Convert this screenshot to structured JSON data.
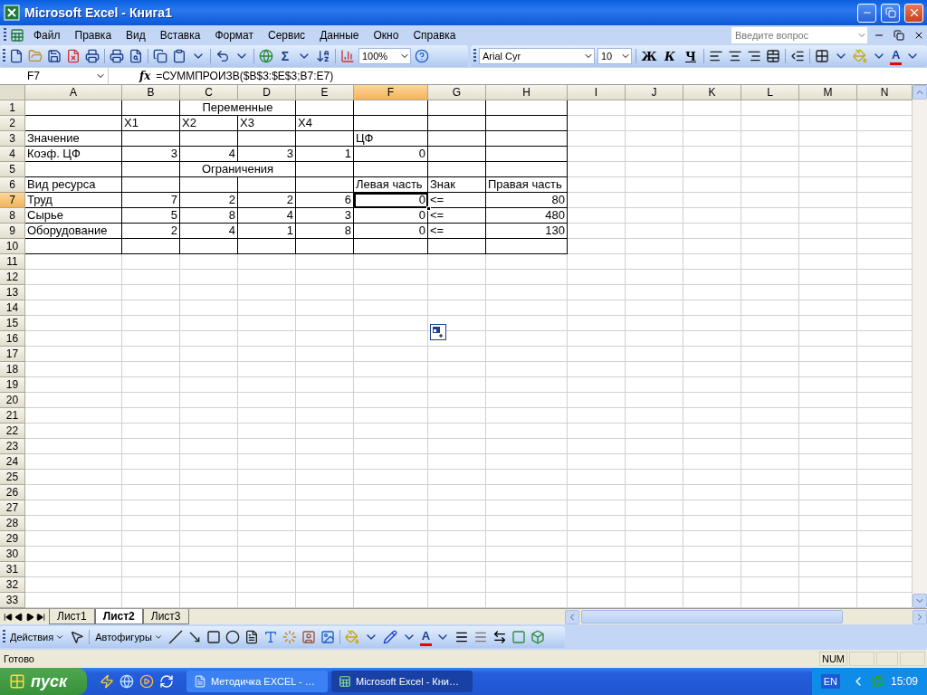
{
  "window": {
    "title": "Microsoft Excel - Книга1"
  },
  "menu": [
    "Файл",
    "Правка",
    "Вид",
    "Вставка",
    "Формат",
    "Сервис",
    "Данные",
    "Окно",
    "Справка"
  ],
  "help_box": {
    "placeholder": "Введите вопрос"
  },
  "standard_toolbar": {
    "zoom": "100%",
    "sum": "Σ"
  },
  "formatting_toolbar": {
    "font": "Arial Cyr",
    "size": "10",
    "bold": "Ж",
    "italic": "К",
    "underline": "Ч",
    "font_color": "A"
  },
  "formula_bar": {
    "name_box": "F7",
    "function_label": "fx",
    "formula": "=СУММПРОИЗВ($B$3:$E$3;B7:E7)"
  },
  "sheet": {
    "columns": [
      {
        "label": "A",
        "selected": false
      },
      {
        "label": "B",
        "selected": false
      },
      {
        "label": "C",
        "selected": false
      },
      {
        "label": "D",
        "selected": false
      },
      {
        "label": "E",
        "selected": false
      },
      {
        "label": "F",
        "selected": true
      },
      {
        "label": "G",
        "selected": false
      },
      {
        "label": "H",
        "selected": false
      },
      {
        "label": "I",
        "selected": false
      },
      {
        "label": "J",
        "selected": false
      },
      {
        "label": "K",
        "selected": false
      },
      {
        "label": "L",
        "selected": false
      },
      {
        "label": "M",
        "selected": false
      },
      {
        "label": "N",
        "selected": false
      }
    ],
    "rows": [
      {
        "number": "1",
        "selected": false,
        "cells": [
          {
            "kind": "empty"
          },
          {
            "kind": "empty"
          },
          {
            "kind": "title",
            "value": "Переменные"
          },
          {
            "kind": "empty"
          },
          {
            "kind": "empty"
          },
          {
            "kind": "empty"
          },
          {
            "kind": "empty"
          }
        ]
      },
      {
        "number": "2",
        "selected": false,
        "cells": [
          {
            "kind": "empty"
          },
          {
            "kind": "text",
            "value": "X1"
          },
          {
            "kind": "text",
            "value": "X2"
          },
          {
            "kind": "text",
            "value": "X3"
          },
          {
            "kind": "text",
            "value": "X4"
          },
          {
            "kind": "empty"
          },
          {
            "kind": "empty"
          },
          {
            "kind": "empty"
          }
        ]
      },
      {
        "number": "3",
        "selected": false,
        "cells": [
          {
            "kind": "text",
            "value": "Значение"
          },
          {
            "kind": "empty"
          },
          {
            "kind": "empty"
          },
          {
            "kind": "empty"
          },
          {
            "kind": "empty"
          },
          {
            "kind": "text",
            "value": "ЦФ"
          },
          {
            "kind": "empty"
          },
          {
            "kind": "empty"
          }
        ]
      },
      {
        "number": "4",
        "selected": false,
        "cells": [
          {
            "kind": "text",
            "value": "Коэф. ЦФ"
          },
          {
            "kind": "number",
            "value": "3"
          },
          {
            "kind": "number",
            "value": "4"
          },
          {
            "kind": "number",
            "value": "3"
          },
          {
            "kind": "number",
            "value": "1"
          },
          {
            "kind": "number",
            "value": "0"
          },
          {
            "kind": "empty"
          },
          {
            "kind": "empty"
          }
        ]
      },
      {
        "number": "5",
        "selected": false,
        "cells": [
          {
            "kind": "empty"
          },
          {
            "kind": "empty"
          },
          {
            "kind": "title",
            "value": "Ограничения"
          },
          {
            "kind": "empty"
          },
          {
            "kind": "empty"
          },
          {
            "kind": "empty"
          },
          {
            "kind": "empty"
          }
        ]
      },
      {
        "number": "6",
        "selected": false,
        "cells": [
          {
            "kind": "text",
            "value": "Вид ресурса"
          },
          {
            "kind": "empty"
          },
          {
            "kind": "empty"
          },
          {
            "kind": "empty"
          },
          {
            "kind": "empty"
          },
          {
            "kind": "text",
            "value": "Левая часть"
          },
          {
            "kind": "text",
            "value": "Знак"
          },
          {
            "kind": "text",
            "value": "Правая часть"
          }
        ]
      },
      {
        "number": "7",
        "selected": true,
        "cells": [
          {
            "kind": "text",
            "value": "Труд"
          },
          {
            "kind": "number",
            "value": "7"
          },
          {
            "kind": "number",
            "value": "2"
          },
          {
            "kind": "number",
            "value": "2"
          },
          {
            "kind": "number",
            "value": "6"
          },
          {
            "kind": "number",
            "value": "0"
          },
          {
            "kind": "text",
            "value": "<="
          },
          {
            "kind": "number",
            "value": "80"
          }
        ]
      },
      {
        "number": "8",
        "selected": false,
        "cells": [
          {
            "kind": "text",
            "value": "Сырье"
          },
          {
            "kind": "number",
            "value": "5"
          },
          {
            "kind": "number",
            "value": "8"
          },
          {
            "kind": "number",
            "value": "4"
          },
          {
            "kind": "number",
            "value": "3"
          },
          {
            "kind": "number",
            "value": "0"
          },
          {
            "kind": "text",
            "value": "<="
          },
          {
            "kind": "number",
            "value": "480"
          }
        ]
      },
      {
        "number": "9",
        "selected": false,
        "cells": [
          {
            "kind": "text",
            "value": "Оборудование"
          },
          {
            "kind": "number",
            "value": "2"
          },
          {
            "kind": "number",
            "value": "4"
          },
          {
            "kind": "number",
            "value": "1"
          },
          {
            "kind": "number",
            "value": "8"
          },
          {
            "kind": "number",
            "value": "0"
          },
          {
            "kind": "text",
            "value": "<="
          },
          {
            "kind": "number",
            "value": "130"
          }
        ]
      },
      {
        "number": "10",
        "selected": false,
        "cells": [
          {
            "kind": "empty"
          },
          {
            "kind": "empty"
          },
          {
            "kind": "empty"
          },
          {
            "kind": "empty"
          },
          {
            "kind": "empty"
          },
          {
            "kind": "empty"
          },
          {
            "kind": "empty"
          },
          {
            "kind": "empty"
          }
        ]
      },
      {
        "number": "11",
        "selected": false
      },
      {
        "number": "12",
        "selected": false
      },
      {
        "number": "13",
        "selected": false
      },
      {
        "number": "14",
        "selected": false
      },
      {
        "number": "15",
        "selected": false
      },
      {
        "number": "16",
        "selected": false
      },
      {
        "number": "17",
        "selected": false
      },
      {
        "number": "18",
        "selected": false
      },
      {
        "number": "19",
        "selected": false
      },
      {
        "number": "20",
        "selected": false
      },
      {
        "number": "21",
        "selected": false
      },
      {
        "number": "22",
        "selected": false
      },
      {
        "number": "23",
        "selected": false
      },
      {
        "number": "24",
        "selected": false
      },
      {
        "number": "25",
        "selected": false
      },
      {
        "number": "26",
        "selected": false
      },
      {
        "number": "27",
        "selected": false
      },
      {
        "number": "28",
        "selected": false
      },
      {
        "number": "29",
        "selected": false
      },
      {
        "number": "30",
        "selected": false
      },
      {
        "number": "31",
        "selected": false
      },
      {
        "number": "32",
        "selected": false
      },
      {
        "number": "33",
        "selected": false
      }
    ]
  },
  "sheet_tabs": [
    {
      "label": "Лист1",
      "selected": false
    },
    {
      "label": "Лист2",
      "selected": true
    },
    {
      "label": "Лист3",
      "selected": false
    }
  ],
  "drawing_toolbar": {
    "actions": "Действия",
    "autoshapes": "Автофигуры",
    "font_color": "A"
  },
  "status_bar": {
    "text": "Готово",
    "num": "NUM"
  },
  "taskbar": {
    "start": "пуск",
    "tasks": [
      {
        "label": "Методичка EXCEL - …",
        "kind": "word",
        "selected": false
      },
      {
        "label": "Microsoft Excel - Кни…",
        "kind": "excel",
        "selected": true
      }
    ],
    "language": "EN",
    "clock": "15:09"
  }
}
